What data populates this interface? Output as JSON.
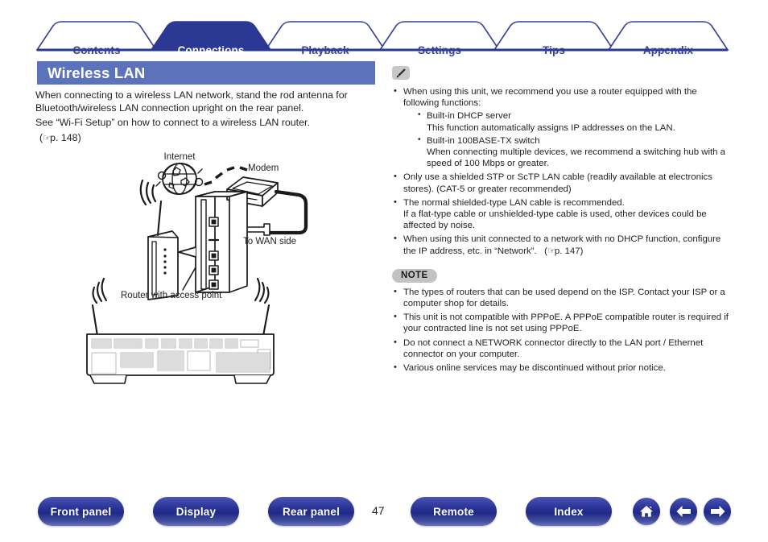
{
  "nav_tabs": [
    {
      "label": "Contents",
      "active": false
    },
    {
      "label": "Connections",
      "active": true
    },
    {
      "label": "Playback",
      "active": false
    },
    {
      "label": "Settings",
      "active": false
    },
    {
      "label": "Tips",
      "active": false
    },
    {
      "label": "Appendix",
      "active": false
    }
  ],
  "page": {
    "title": "Wireless LAN",
    "number": "47",
    "title_bar_color": "#5c72bb",
    "accent_color": "#33409a"
  },
  "intro": {
    "paragraph1": "When connecting to a wireless LAN network, stand the rod antenna for Bluetooth/wireless LAN connection upright on the rear panel.",
    "paragraph2": "See “Wi-Fi Setup” on how to connect to a wireless LAN router.",
    "reference": "p. 148",
    "reference_prefix": "(",
    "reference_suffix": ")"
  },
  "diagram": {
    "labels": {
      "internet": "Internet",
      "modem": "Modem",
      "wan": "To WAN side",
      "router": "Router with access point"
    }
  },
  "tip_block": {
    "icon": "pencil-icon",
    "items": [
      {
        "text": "When using this unit, we recommend you use a router equipped with the following functions:",
        "sub_items": [
          {
            "title": "Built-in DHCP server",
            "desc": "This function automatically assigns IP addresses on the LAN."
          },
          {
            "title": "Built-in 100BASE-TX switch",
            "desc": "When connecting multiple devices, we recommend a switching hub with a speed of 100 Mbps or greater."
          }
        ]
      },
      {
        "text": "Only use a shielded STP or ScTP LAN cable (readily available at electronics stores). (CAT-5 or greater recommended)",
        "sub_items": []
      },
      {
        "text": "The normal shielded-type LAN cable is recommended.",
        "extra": "If a flat-type cable or unshielded-type cable is used, other devices could be affected by noise.",
        "sub_items": []
      },
      {
        "text": "When using this unit connected to a network with no DHCP function, configure the IP address, etc. in “Network”.",
        "reference": "p. 147",
        "sub_items": []
      }
    ]
  },
  "note_block": {
    "badge": "NOTE",
    "items": [
      "The types of routers that can be used depend on the ISP. Contact your ISP or a computer shop for details.",
      "This unit is not compatible with PPPoE. A PPPoE compatible router is required if your contracted line is not set using PPPoE.",
      "Do not connect a NETWORK connector directly to the LAN port / Ethernet connector on your computer.",
      "Various online services may be discontinued without prior notice."
    ]
  },
  "footer": {
    "buttons": [
      {
        "label": "Front panel",
        "name": "front-panel-button"
      },
      {
        "label": "Display",
        "name": "display-button"
      },
      {
        "label": "Rear panel",
        "name": "rear-panel-button"
      },
      {
        "label": "Remote",
        "name": "remote-button"
      },
      {
        "label": "Index",
        "name": "index-button"
      }
    ],
    "icon_buttons": [
      {
        "icon": "home-icon"
      },
      {
        "icon": "arrow-left-icon"
      },
      {
        "icon": "arrow-right-icon"
      }
    ]
  }
}
